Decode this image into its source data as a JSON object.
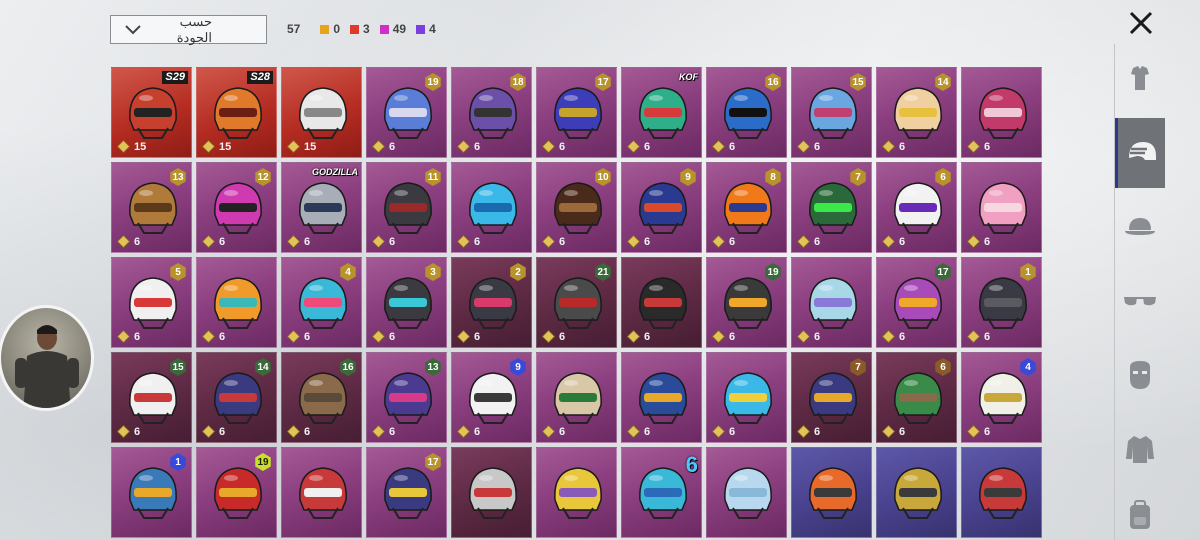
{
  "sort": {
    "label": "حسب الجودة"
  },
  "counts": {
    "total": "57",
    "items": [
      {
        "value": "0",
        "color": "#e8a31c"
      },
      {
        "value": "3",
        "color": "#e0392b"
      },
      {
        "value": "49",
        "color": "#d12ec8"
      },
      {
        "value": "4",
        "color": "#7b3fe0"
      }
    ]
  },
  "rail": [
    "outfit-icon",
    "helmet-icon",
    "cap-icon",
    "glasses-icon",
    "mask-icon",
    "jacket-icon",
    "backpack-icon"
  ],
  "tiles": [
    {
      "q": "q-red",
      "badge": "S29",
      "btype": "season",
      "pts": "15",
      "c1": "#c7402e",
      "c2": "#222"
    },
    {
      "q": "q-red",
      "badge": "S28",
      "btype": "season",
      "pts": "15",
      "c1": "#e07a2a",
      "c2": "#6b1f12"
    },
    {
      "q": "q-red",
      "badge": "",
      "btype": "",
      "pts": "15",
      "c1": "#e8e8e8",
      "c2": "#888"
    },
    {
      "q": "q-pink",
      "badge": "19",
      "btype": "gold",
      "pts": "6",
      "c1": "#5a7ed8",
      "c2": "#d8d8f0"
    },
    {
      "q": "q-pink",
      "badge": "18",
      "btype": "gold",
      "pts": "6",
      "c1": "#6b4fa8",
      "c2": "#333"
    },
    {
      "q": "q-pink",
      "badge": "17",
      "btype": "gold",
      "pts": "6",
      "c1": "#3d3db8",
      "c2": "#c5a32c"
    },
    {
      "q": "q-pink",
      "badge": "KOF",
      "btype": "special",
      "pts": "6",
      "c1": "#2fae8a",
      "c2": "#d63a3a"
    },
    {
      "q": "q-pink",
      "badge": "16",
      "btype": "gold",
      "pts": "6",
      "c1": "#2a6cc8",
      "c2": "#111"
    },
    {
      "q": "q-pink",
      "badge": "15",
      "btype": "gold",
      "pts": "6",
      "c1": "#6aa7e0",
      "c2": "#c04070"
    },
    {
      "q": "q-pink",
      "badge": "14",
      "btype": "gold",
      "pts": "6",
      "c1": "#f0d0a0",
      "c2": "#e8c040"
    },
    {
      "q": "q-pink",
      "badge": "",
      "btype": "",
      "pts": "6",
      "c1": "#c23a6a",
      "c2": "#f0c8d8"
    },
    {
      "q": "q-pink",
      "badge": "13",
      "btype": "gold",
      "pts": "6",
      "c1": "#b07a3a",
      "c2": "#5a3a1a"
    },
    {
      "q": "q-pink",
      "badge": "12",
      "btype": "gold",
      "pts": "6",
      "c1": "#d03ab0",
      "c2": "#222"
    },
    {
      "q": "q-pink",
      "badge": "GODZILLA",
      "btype": "special",
      "pts": "6",
      "c1": "#a8aeb8",
      "c2": "#2a3a58"
    },
    {
      "q": "q-pink",
      "badge": "11",
      "btype": "gold",
      "pts": "6",
      "c1": "#3a3a40",
      "c2": "#9a2a2a"
    },
    {
      "q": "q-pink",
      "badge": "",
      "btype": "",
      "pts": "6",
      "c1": "#3ab8e8",
      "c2": "#1a6ab0"
    },
    {
      "q": "q-pink",
      "badge": "10",
      "btype": "gold",
      "pts": "6",
      "c1": "#4a2a1a",
      "c2": "#9a6a3a"
    },
    {
      "q": "q-pink",
      "badge": "9",
      "btype": "gold",
      "pts": "6",
      "c1": "#2a3a90",
      "c2": "#d84a2a"
    },
    {
      "q": "q-pink",
      "badge": "8",
      "btype": "gold",
      "pts": "6",
      "c1": "#f07a1a",
      "c2": "#2a3a90"
    },
    {
      "q": "q-pink",
      "badge": "7",
      "btype": "gold",
      "pts": "6",
      "c1": "#2a6a3a",
      "c2": "#3ae84a"
    },
    {
      "q": "q-pink",
      "badge": "6",
      "btype": "gold",
      "pts": "6",
      "c1": "#f2f2f2",
      "c2": "#6a2ab8"
    },
    {
      "q": "q-pink",
      "badge": "",
      "btype": "",
      "pts": "6",
      "c1": "#f0a0c0",
      "c2": "#f8d8e0"
    },
    {
      "q": "q-pink",
      "badge": "5",
      "btype": "gold",
      "pts": "6",
      "c1": "#f0f0f0",
      "c2": "#d83a3a"
    },
    {
      "q": "q-pink",
      "badge": "",
      "btype": "",
      "pts": "6",
      "c1": "#f09a2a",
      "c2": "#3ab8b8"
    },
    {
      "q": "q-pink",
      "badge": "4",
      "btype": "gold",
      "pts": "6",
      "c1": "#3ab8d8",
      "c2": "#f04a7a"
    },
    {
      "q": "q-pink",
      "badge": "3",
      "btype": "gold",
      "pts": "6",
      "c1": "#3a3a40",
      "c2": "#3ac8d8"
    },
    {
      "q": "q-dark",
      "badge": "2",
      "btype": "gold",
      "pts": "6",
      "c1": "#3a3a44",
      "c2": "#d83a6a"
    },
    {
      "q": "q-dark",
      "badge": "21",
      "btype": "green",
      "pts": "6",
      "c1": "#4a4a4a",
      "c2": "#b82a2a"
    },
    {
      "q": "q-dark",
      "badge": "",
      "btype": "",
      "pts": "6",
      "c1": "#2a2a2a",
      "c2": "#c83a3a"
    },
    {
      "q": "q-pink",
      "badge": "19",
      "btype": "green",
      "pts": "6",
      "c1": "#3a3a3a",
      "c2": "#f0a82a"
    },
    {
      "q": "q-pink",
      "badge": "",
      "btype": "",
      "pts": "6",
      "c1": "#a8d8e8",
      "c2": "#8a7ad8"
    },
    {
      "q": "q-pink",
      "badge": "17",
      "btype": "green",
      "pts": "6",
      "c1": "#a84ab8",
      "c2": "#f0a82a"
    },
    {
      "q": "q-pink",
      "badge": "1",
      "btype": "gold",
      "pts": "6",
      "c1": "#3a3a44",
      "c2": "#5a5a60"
    },
    {
      "q": "q-dark",
      "badge": "15",
      "btype": "green",
      "pts": "6",
      "c1": "#f0f0f0",
      "c2": "#c83a3a"
    },
    {
      "q": "q-dark",
      "badge": "14",
      "btype": "green",
      "pts": "6",
      "c1": "#3a3a80",
      "c2": "#c83a3a"
    },
    {
      "q": "q-dark",
      "badge": "16",
      "btype": "green",
      "pts": "6",
      "c1": "#8a6a4a",
      "c2": "#5a4a3a"
    },
    {
      "q": "q-pink",
      "badge": "13",
      "btype": "green",
      "pts": "6",
      "c1": "#4a3a90",
      "c2": "#d83a8a"
    },
    {
      "q": "q-pink",
      "badge": "9",
      "btype": "blue",
      "pts": "6",
      "c1": "#f2f2f2",
      "c2": "#3a3a3a"
    },
    {
      "q": "q-pink",
      "badge": "",
      "btype": "",
      "pts": "6",
      "c1": "#d8c8a8",
      "c2": "#2a7a3a"
    },
    {
      "q": "q-pink",
      "badge": "",
      "btype": "",
      "pts": "6",
      "c1": "#2a4a9a",
      "c2": "#e8a82a"
    },
    {
      "q": "q-pink",
      "badge": "",
      "btype": "",
      "pts": "6",
      "c1": "#3ab8e8",
      "c2": "#f0d03a"
    },
    {
      "q": "q-dark",
      "badge": "7",
      "btype": "bronze",
      "pts": "6",
      "c1": "#3a3a80",
      "c2": "#e8a82a"
    },
    {
      "q": "q-dark",
      "badge": "6",
      "btype": "bronze",
      "pts": "6",
      "c1": "#3a8a4a",
      "c2": "#8a6a4a"
    },
    {
      "q": "q-pink",
      "badge": "4",
      "btype": "blue",
      "pts": "6",
      "c1": "#f0f0e8",
      "c2": "#c8a83a"
    },
    {
      "q": "q-pink",
      "badge": "1",
      "btype": "blue",
      "pts": "",
      "c1": "#3a7ab8",
      "c2": "#e8a82a"
    },
    {
      "q": "q-pink",
      "badge": "19",
      "btype": "lime",
      "pts": "",
      "c1": "#c82a2a",
      "c2": "#e8a82a"
    },
    {
      "q": "q-pink",
      "badge": "",
      "btype": "",
      "pts": "",
      "c1": "#c83a3a",
      "c2": "#f0f0f0"
    },
    {
      "q": "q-pink",
      "badge": "17",
      "btype": "gold",
      "pts": "",
      "c1": "#3a3a80",
      "c2": "#e8c83a"
    },
    {
      "q": "q-dark",
      "badge": "",
      "btype": "",
      "pts": "",
      "c1": "#c8c8c8",
      "c2": "#c83a3a"
    },
    {
      "q": "q-pink",
      "badge": "",
      "btype": "",
      "pts": "",
      "c1": "#e8c83a",
      "c2": "#8a5ab8"
    },
    {
      "q": "q-pink",
      "badge": "6",
      "btype": "bignum",
      "pts": "",
      "c1": "#3ab8d8",
      "c2": "#2a6ab8"
    },
    {
      "q": "q-pink",
      "badge": "",
      "btype": "",
      "pts": "",
      "c1": "#b8d8f0",
      "c2": "#8ab8d8"
    },
    {
      "q": "q-purple",
      "badge": "",
      "btype": "",
      "pts": "",
      "c1": "#e86a2a",
      "c2": "#3a3a3a"
    },
    {
      "q": "q-purple",
      "badge": "",
      "btype": "",
      "pts": "",
      "c1": "#c8a83a",
      "c2": "#3a3a3a"
    },
    {
      "q": "q-purple",
      "badge": "",
      "btype": "",
      "pts": "",
      "c1": "#c83a3a",
      "c2": "#3a3a3a"
    }
  ]
}
